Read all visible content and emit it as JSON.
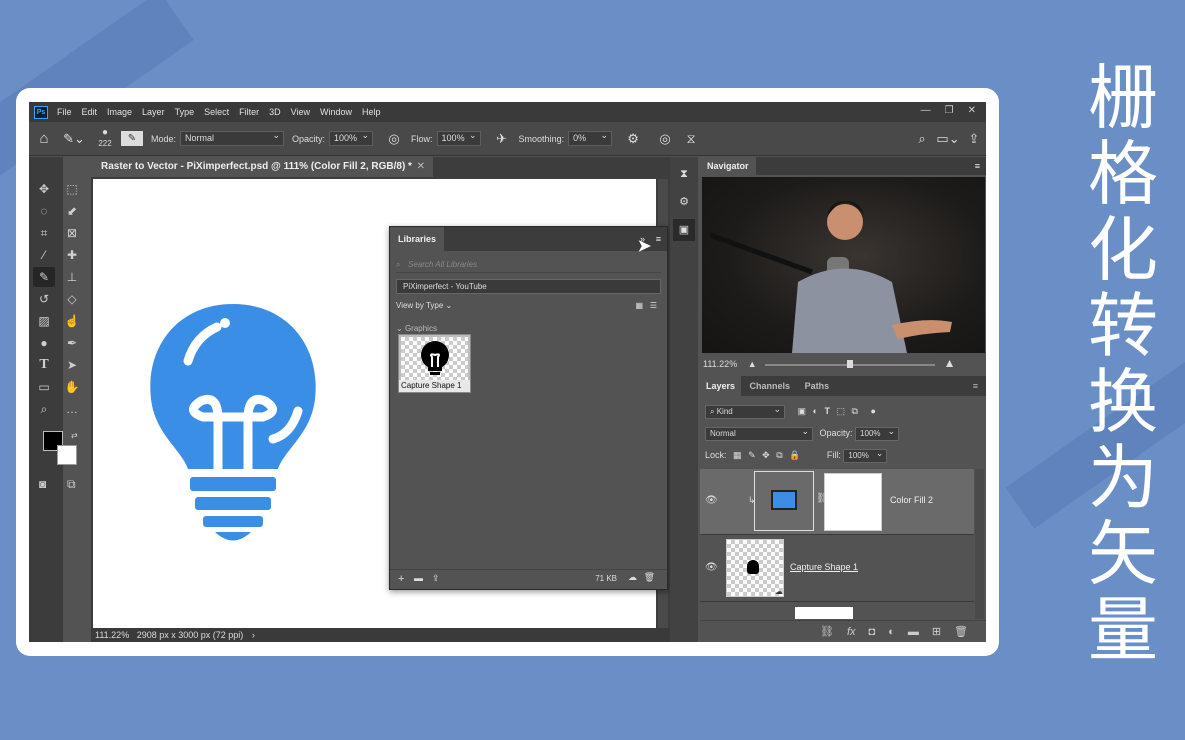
{
  "side_title": "栅格化转换为矢量",
  "menubar": {
    "logo": "Ps",
    "items": [
      "File",
      "Edit",
      "Image",
      "Layer",
      "Type",
      "Select",
      "Filter",
      "3D",
      "View",
      "Window",
      "Help"
    ],
    "window_buttons": [
      "—",
      "❐",
      "✕"
    ]
  },
  "options": {
    "brush_size": "222",
    "mode_label": "Mode:",
    "mode_value": "Normal",
    "opacity_label": "Opacity:",
    "opacity_value": "100%",
    "flow_label": "Flow:",
    "flow_value": "100%",
    "smoothing_label": "Smoothing:",
    "smoothing_value": "0%"
  },
  "document": {
    "tab_title": "Raster to Vector - PiXimperfect.psd @ 111% (Color Fill 2, RGB/8) *",
    "status_zoom": "111.22%",
    "status_info": "2908 px x 3000 px (72 ppi)",
    "bulb_color": "#3a8ee6"
  },
  "libraries": {
    "title": "Libraries",
    "search_placeholder": "Search All Libraries",
    "library_name": "PiXimperfect - YouTube",
    "view_by": "View by Type",
    "group": "Graphics",
    "item_name": "Capture Shape 1",
    "storage": "71 KB"
  },
  "navigator": {
    "title": "Navigator",
    "zoom": "111.22%"
  },
  "layers": {
    "tabs": [
      "Layers",
      "Channels",
      "Paths"
    ],
    "filter_kind": "Kind",
    "blend_mode": "Normal",
    "opacity_label": "Opacity:",
    "opacity_value": "100%",
    "lock_label": "Lock:",
    "fill_label": "Fill:",
    "fill_value": "100%",
    "items": [
      {
        "name": "Color Fill 2"
      },
      {
        "name": "Capture Shape 1"
      }
    ]
  }
}
